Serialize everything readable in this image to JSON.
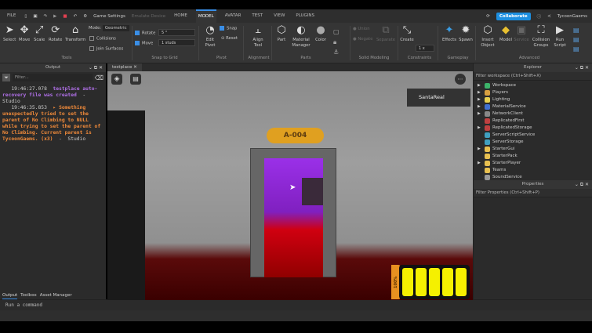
{
  "menubar": {
    "file": "FILE",
    "game_settings": "Game Settings",
    "emulate_device": "Emulate Device",
    "tabs": [
      "HOME",
      "MODEL",
      "AVATAR",
      "TEST",
      "VIEW",
      "PLUGINS"
    ],
    "active_tab": "MODEL",
    "collaborate": "Collaborate",
    "user": "TycoonGaems"
  },
  "ribbon": {
    "tools": [
      "Select",
      "Move",
      "Scale",
      "Rotate",
      "Transform"
    ],
    "mode_label": "Mode:",
    "mode_value": "Geometric",
    "collisions": "Collisions",
    "join_surfaces": "Join Surfaces",
    "rotate_label": "Rotate",
    "rotate_value": "5 °",
    "move_label": "Move",
    "move_value": "1 studs",
    "edit_pivot": "Edit Pivot",
    "snap": "Snap",
    "reset": "Reset",
    "align_tool": "Align Tool",
    "part": "Part",
    "material_manager": "Material Manager",
    "color": "Color",
    "union": "Union",
    "negate": "Negate",
    "separate": "Separate",
    "create": "Create",
    "constraint_scale": "1 x",
    "effects": "Effects",
    "spawn": "Spawn",
    "insert_object": "Insert Object",
    "model": "Model",
    "service": "Service",
    "collision_groups": "Collision Groups",
    "run_script": "Run Script",
    "groups": [
      "Tools",
      "Snap to Grid",
      "Pivot",
      "Alignment",
      "Parts",
      "Solid Modeling",
      "Constraints",
      "Gameplay",
      "Advanced"
    ]
  },
  "output": {
    "title": "Output",
    "filter_placeholder": "Filter...",
    "entries": [
      {
        "time": "19:46:27.078",
        "message": "testplace auto-recovery file was created",
        "source": "Studio"
      },
      {
        "time": "19:46:35.853",
        "message": "Something unexpectedly tried to set the parent of No Climbing to NULL while trying to set the parent of No Climbing. Current parent is TycoonGaems. (x3)",
        "source": "Studio"
      }
    ]
  },
  "bottom_tabs": [
    "Output",
    "Toolbox",
    "Asset Manager"
  ],
  "command_placeholder": "Run a command",
  "viewport": {
    "tab": "testplace",
    "player_name": "SantaReal",
    "door_sign": "A-004",
    "battery_label": "100%",
    "battery_level": 1.0,
    "battery_segments": 5
  },
  "explorer": {
    "title": "Explorer",
    "filter": "Filter workspace (Ctrl+Shift+X)",
    "items": [
      {
        "name": "Workspace",
        "expand": true,
        "color": "#3cb46a"
      },
      {
        "name": "Players",
        "expand": true,
        "color": "#d8a040"
      },
      {
        "name": "Lighting",
        "expand": true,
        "color": "#e8d050"
      },
      {
        "name": "MaterialService",
        "expand": true,
        "color": "#4070d0"
      },
      {
        "name": "NetworkClient",
        "expand": true,
        "color": "#888888"
      },
      {
        "name": "ReplicatedFirst",
        "expand": false,
        "color": "#c04040"
      },
      {
        "name": "ReplicatedStorage",
        "expand": true,
        "color": "#c04040"
      },
      {
        "name": "ServerScriptService",
        "expand": false,
        "color": "#40a0c0"
      },
      {
        "name": "ServerStorage",
        "expand": false,
        "color": "#40a0c0"
      },
      {
        "name": "StarterGui",
        "expand": true,
        "color": "#e8c050"
      },
      {
        "name": "StarterPack",
        "expand": false,
        "color": "#e8c050"
      },
      {
        "name": "StarterPlayer",
        "expand": true,
        "color": "#e8c050"
      },
      {
        "name": "Teams",
        "expand": false,
        "color": "#e8c050"
      },
      {
        "name": "SoundService",
        "expand": false,
        "color": "#999999"
      }
    ]
  },
  "properties": {
    "title": "Properties",
    "filter": "Filter Properties (Ctrl+Shift+P)"
  }
}
